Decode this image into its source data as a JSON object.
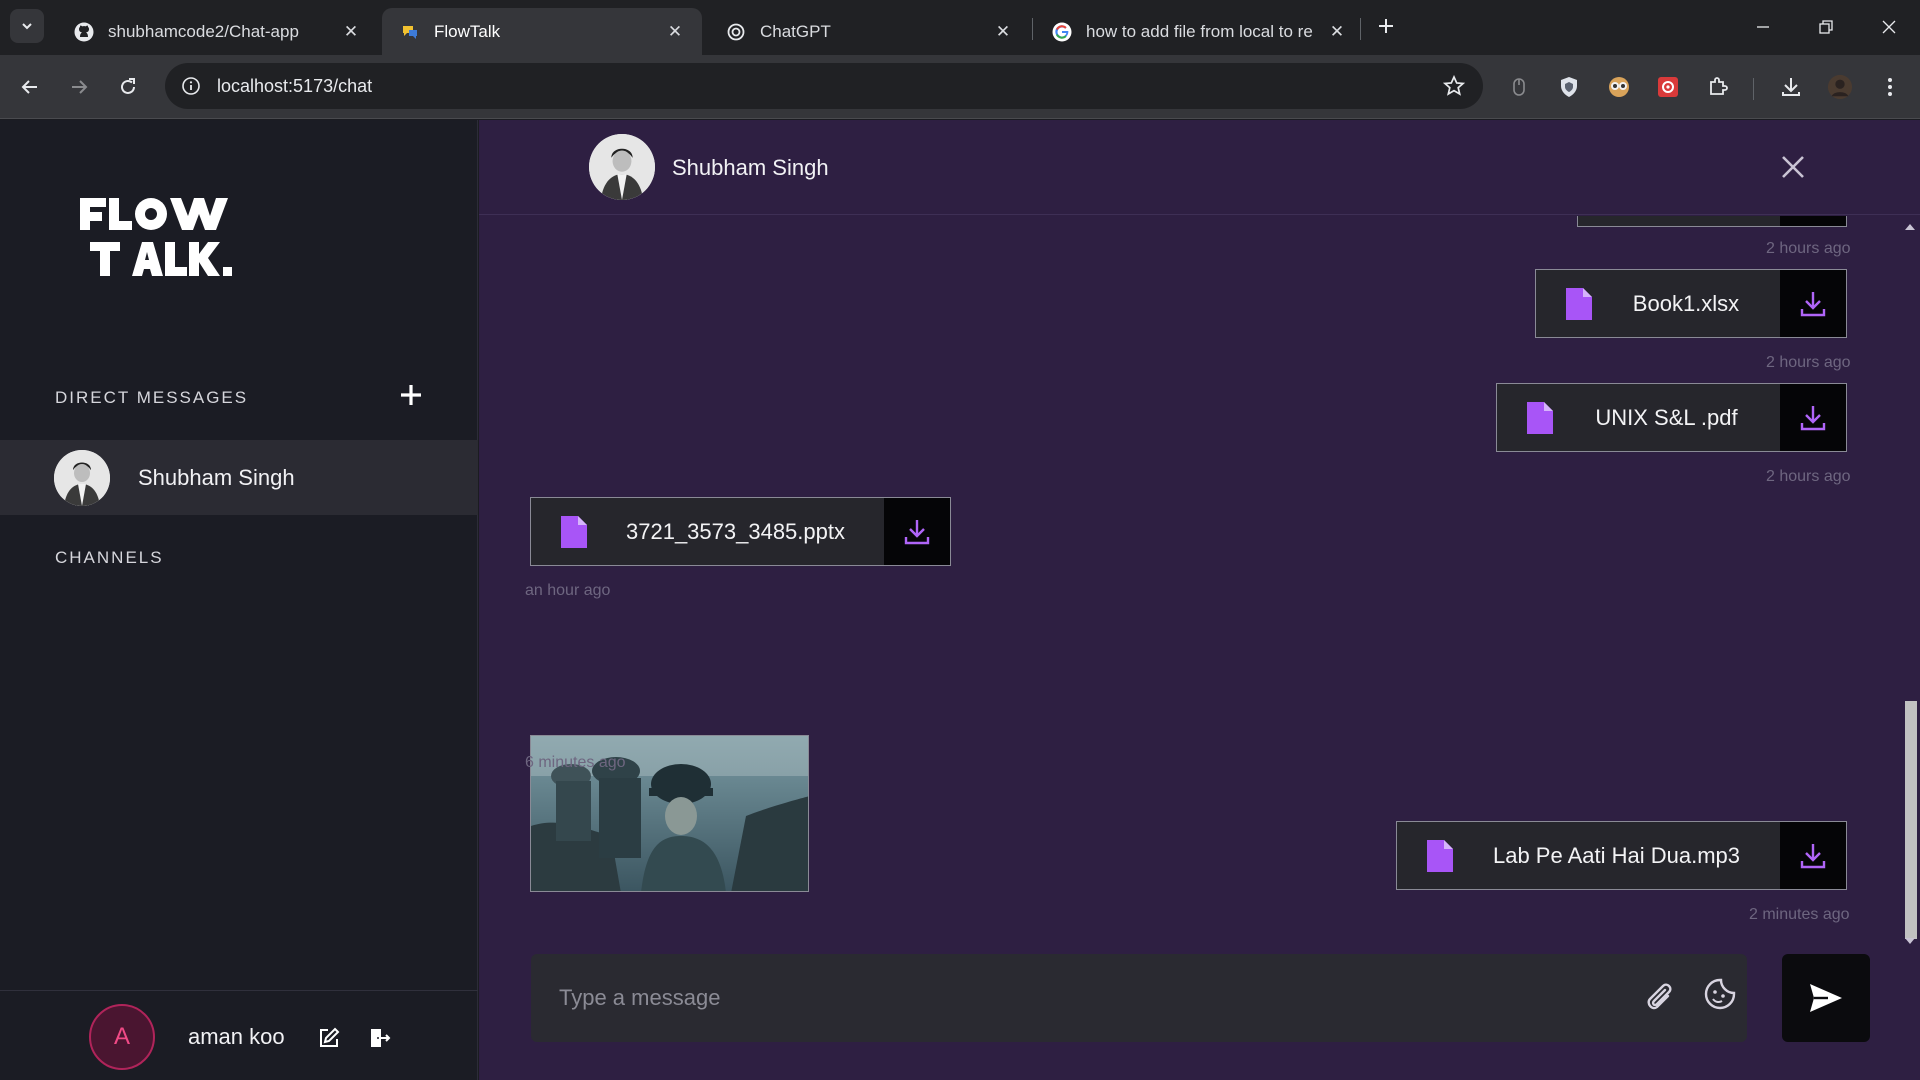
{
  "browser": {
    "tabs": [
      {
        "title": "shubhamcode2/Chat-app",
        "icon": "github-icon",
        "active": false
      },
      {
        "title": "FlowTalk",
        "icon": "flowtalk-favicon",
        "active": true
      },
      {
        "title": "ChatGPT",
        "icon": "chatgpt-icon",
        "active": false
      },
      {
        "title": "how to add file from local to re",
        "icon": "google-icon",
        "active": false
      }
    ],
    "url": "localhost:5173/chat"
  },
  "sidebar": {
    "direct_messages_label": "DIRECT MESSAGES",
    "contacts": [
      {
        "name": "Shubham Singh"
      }
    ],
    "channels_label": "CHANNELS",
    "user": {
      "initial": "A",
      "name": "aman koo"
    }
  },
  "chat": {
    "contact_name": "Shubham Singh",
    "messages": [
      {
        "type": "file",
        "name": "Book1.xlsx",
        "time": "2 hours ago",
        "side": "right"
      },
      {
        "type": "file",
        "name": "UNIX S&L .pdf",
        "time": "2 hours ago",
        "side": "right"
      },
      {
        "type": "file",
        "name": "3721_3573_3485.pptx",
        "time": "an hour ago",
        "side": "left"
      },
      {
        "type": "image",
        "time": "6 minutes ago",
        "side": "left"
      },
      {
        "type": "file",
        "name": "Lab Pe Aati Hai Dua.mp3",
        "time": "2 minutes ago",
        "side": "right"
      }
    ],
    "top_time": "2 hours ago",
    "input_placeholder": "Type a message"
  },
  "colors": {
    "accent_purple": "#a855f7",
    "chat_bg": "#2e1f42",
    "sidebar_bg": "#1b1c24",
    "user_avatar": "#f04a86"
  }
}
